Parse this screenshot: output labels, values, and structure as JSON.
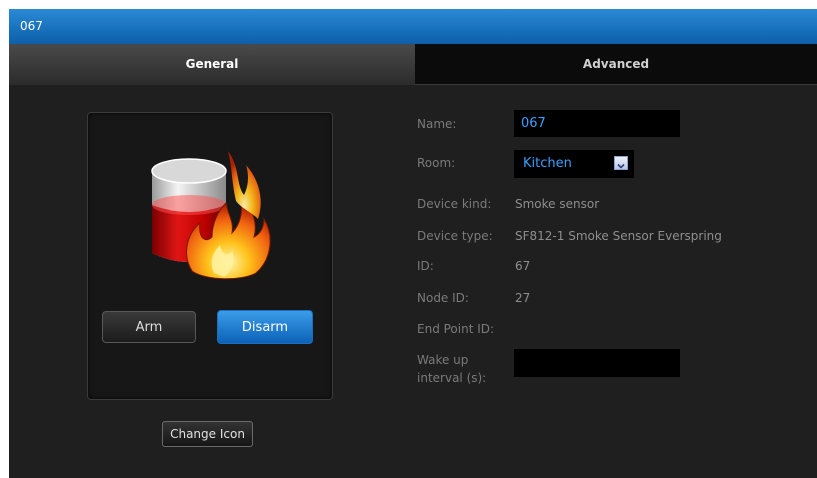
{
  "window": {
    "title": "067"
  },
  "tabs": [
    {
      "label": "General",
      "active": true
    },
    {
      "label": "Advanced",
      "active": false
    }
  ],
  "device": {
    "icon": "smoke-sensor-fire-icon",
    "arm_label": "Arm",
    "disarm_label": "Disarm",
    "change_icon_label": "Change Icon"
  },
  "fields": {
    "name": {
      "label": "Name:",
      "value": "067"
    },
    "room": {
      "label": "Room:",
      "value": "Kitchen"
    },
    "device_kind": {
      "label": "Device kind:",
      "value": "Smoke sensor"
    },
    "device_type": {
      "label": "Device type:",
      "value": "SF812-1 Smoke Sensor Everspring"
    },
    "id": {
      "label": "ID:",
      "value": "67"
    },
    "node_id": {
      "label": "Node ID:",
      "value": "27"
    },
    "end_point_id": {
      "label": "End Point ID:",
      "value": ""
    },
    "wake_up_interval": {
      "label_line1": "Wake up",
      "label_line2": "interval (s):",
      "value": ""
    }
  },
  "colors": {
    "title_bar": "#1a74c4",
    "accent_text": "#3aa0ff",
    "disarm_button": "#1a74c4"
  }
}
